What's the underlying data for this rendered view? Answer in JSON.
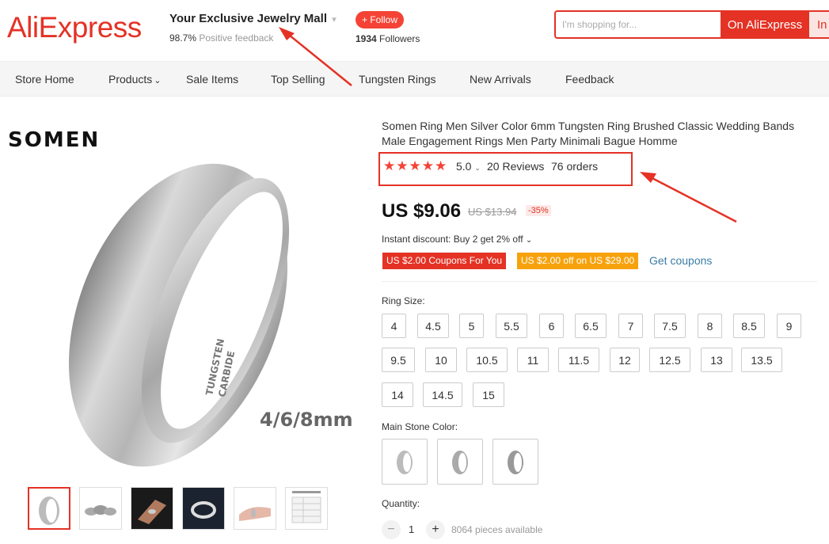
{
  "header": {
    "logo": "AliExpress",
    "store_name": "Your Exclusive Jewelry Mall",
    "feedback_pct": "98.7%",
    "feedback_label": "Positive feedback",
    "follow_label": "+ Follow",
    "followers_count": "1934",
    "followers_label": "Followers",
    "search_placeholder": "I'm shopping for...",
    "search_button": "On AliExpress",
    "search_button2": "In"
  },
  "nav": {
    "items": [
      "Store Home",
      "Products",
      "Sale Items",
      "Top Selling",
      "Tungsten Rings",
      "New Arrivals",
      "Feedback"
    ]
  },
  "gallery": {
    "brand": "SOMEN",
    "width_text": "4/6/8mm",
    "ring_engraving_1": "TUNGSTEN",
    "ring_engraving_2": "CARBIDE"
  },
  "product": {
    "title": "Somen Ring Men Silver Color 6mm Tungsten Ring Brushed Classic Wedding Bands Male Engagement Rings Men Party Minimali Bague Homme",
    "rating": "5.0",
    "reviews": "20 Reviews",
    "orders": "76 orders",
    "price": "US $9.06",
    "old_price": "US $13.94",
    "discount": "-35%",
    "instant_discount": "Instant discount: Buy 2 get 2% off",
    "coupon1": "US $2.00 Coupons For You",
    "coupon2": "US $2.00 off on US $29.00",
    "get_coupons": "Get coupons",
    "ring_size_label": "Ring Size:",
    "sizes": [
      "4",
      "4.5",
      "5",
      "5.5",
      "6",
      "6.5",
      "7",
      "7.5",
      "8",
      "8.5",
      "9",
      "9.5",
      "10",
      "10.5",
      "11",
      "11.5",
      "12",
      "12.5",
      "13",
      "13.5",
      "14",
      "14.5",
      "15"
    ],
    "stone_color_label": "Main Stone Color:",
    "quantity_label": "Quantity:",
    "quantity": "1",
    "available": "8064 pieces available"
  },
  "colors": {
    "accent": "#e43225",
    "star": "#f44336",
    "coupon_orange": "#f7a20c",
    "link": "#3a7ca5"
  }
}
